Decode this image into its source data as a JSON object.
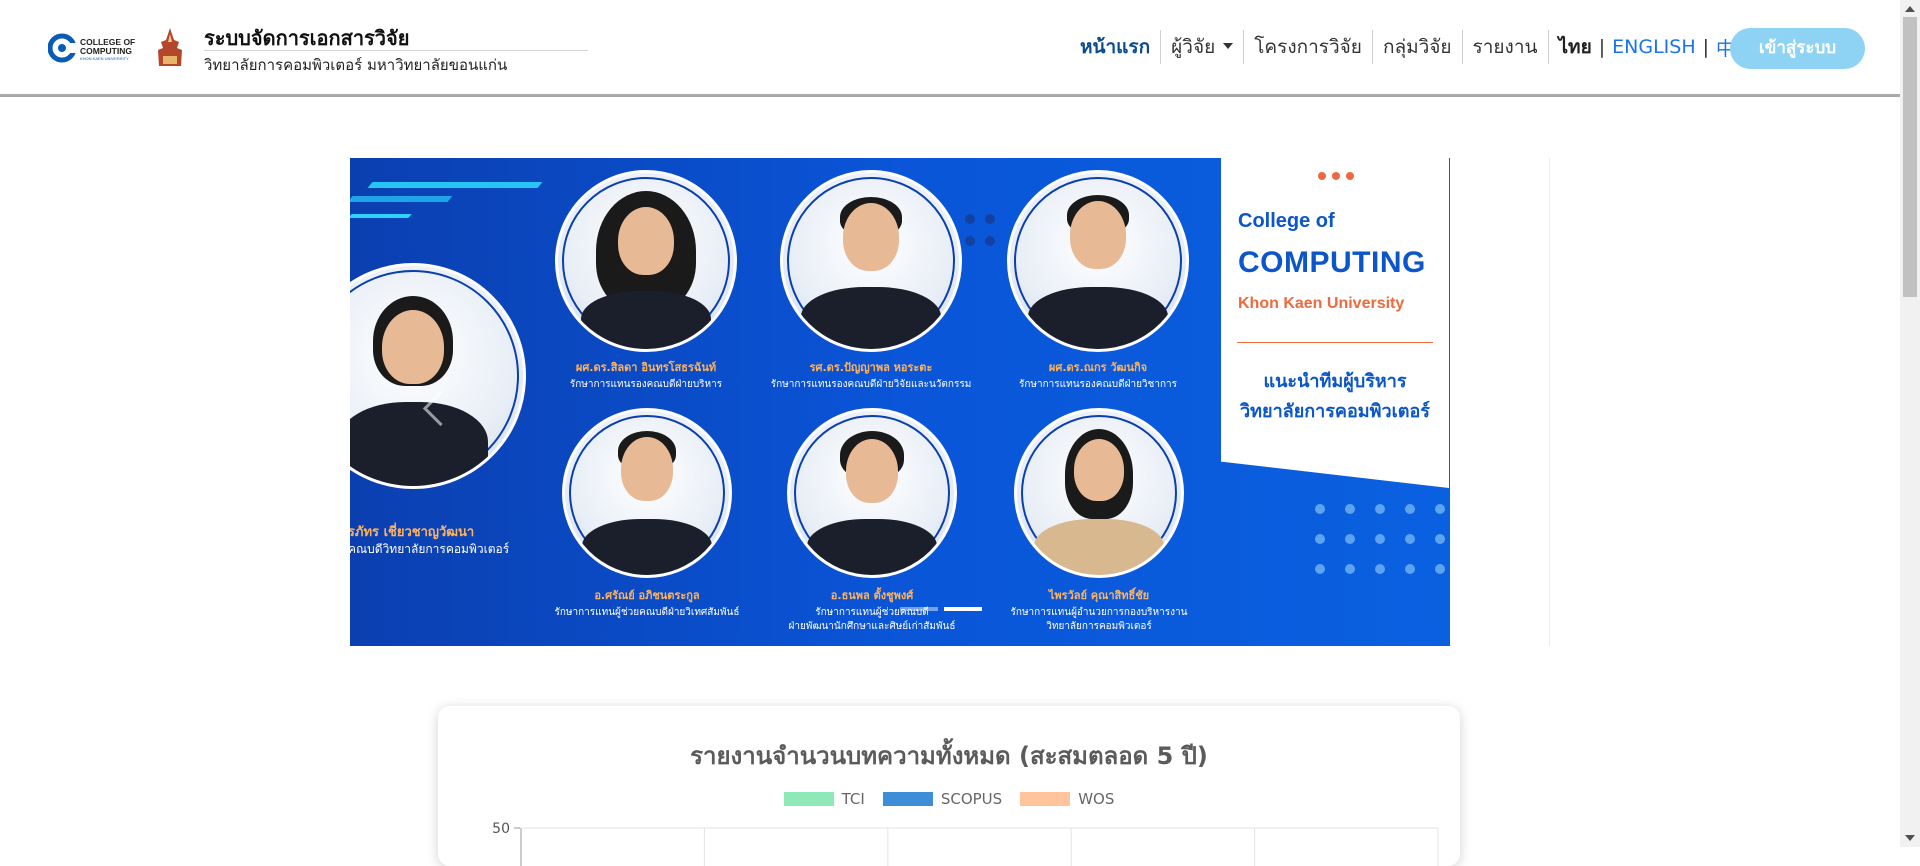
{
  "header": {
    "logo_text_line1": "COLLEGE OF",
    "logo_text_line2": "COMPUTING",
    "logo_text_line3": "KHON KAEN UNIVERSITY",
    "title": "ระบบจัดการเอกสารวิจัย",
    "subtitle": "วิทยาลัยการคอมพิวเตอร์ มหาวิทยาลัยขอนแก่น"
  },
  "nav": {
    "items": [
      {
        "label": "หน้าแรก",
        "active": true
      },
      {
        "label": "ผู้วิจัย",
        "dropdown": true
      },
      {
        "label": "โครงการวิจัย"
      },
      {
        "label": "กลุ่มวิจัย"
      },
      {
        "label": "รายงาน"
      }
    ],
    "languages": [
      "ไทย",
      "ENGLISH",
      "中文"
    ],
    "lang_separator": "|",
    "login_label": "เข้าสู่ระบบ"
  },
  "banner": {
    "card_line1": "College of",
    "card_line2": "COMPUTING",
    "card_line3": "Khon Kaen University",
    "card_line4": "แนะนำทีมผู้บริหาร",
    "card_line5": "วิทยาลัยการคอมพิวเตอร์",
    "people": [
      {
        "name": "สิรภัทร เชี่ยวชาญวัฒนา",
        "role": "คณบดีวิทยาลัยการคอมพิวเตอร์"
      },
      {
        "name": "ผศ.ดร.สิลดา อินทรโสธรฉันท์",
        "role": "รักษาการแทนรองคณบดีฝ่ายบริหาร"
      },
      {
        "name": "รศ.ดร.ปัญญาพล หอระตะ",
        "role": "รักษาการแทนรองคณบดีฝ่ายวิจัยและนวัตกรรม"
      },
      {
        "name": "ผศ.ดร.ณกร วัฒนกิจ",
        "role": "รักษาการแทนรองคณบดีฝ่ายวิชาการ"
      },
      {
        "name": "อ.ศรัณย์ อภิชนตระกูล",
        "role": "รักษาการแทนผู้ช่วยคณบดีฝ่ายวิเทศสัมพันธ์"
      },
      {
        "name": "อ.ธนพล ตั้งชูพงศ์",
        "role": "รักษาการแทนผู้ช่วยคณบดี",
        "role2": "ฝ่ายพัฒนานักศึกษาและศิษย์เก่าสัมพันธ์"
      },
      {
        "name": "ไพรวัลย์ คุณาสิทธิ์ชัย",
        "role": "รักษาการแทนผู้อำนวยการกองบริหารงาน",
        "role2": "วิทยาลัยการคอมพิวเตอร์"
      }
    ]
  },
  "report": {
    "title": "รายงานจำนวนบทความทั้งหมด (สะสมตลอด 5 ปี)",
    "legend": [
      {
        "label": "TCI",
        "color": "#8ee8b8"
      },
      {
        "label": "SCOPUS",
        "color": "#3d8ed6"
      },
      {
        "label": "WOS",
        "color": "#ffc49c"
      }
    ]
  },
  "chart_data": {
    "type": "bar",
    "title": "รายงานจำนวนบทความทั้งหมด (สะสมตลอด 5 ปี)",
    "series": [
      {
        "name": "TCI",
        "values": []
      },
      {
        "name": "SCOPUS",
        "values": []
      },
      {
        "name": "WOS",
        "values": []
      }
    ],
    "y_tick_visible": "50",
    "legend_position": "top",
    "grid": true
  }
}
